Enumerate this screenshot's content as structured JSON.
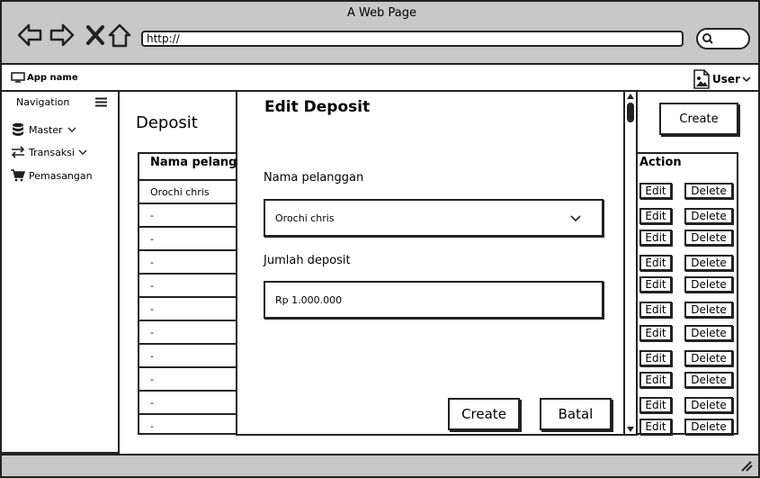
{
  "window": {
    "title": "A Web Page",
    "url": "http://"
  },
  "app": {
    "name": "App name",
    "user": "User"
  },
  "sidebar": {
    "title": "Navigation",
    "items": [
      {
        "label": "Master",
        "icon": "database-icon"
      },
      {
        "label": "Transaksi",
        "icon": "transfer-icon"
      },
      {
        "label": "Pemasangan",
        "icon": "cart-icon"
      }
    ]
  },
  "main": {
    "title": "Deposit",
    "create_label": "Create",
    "table": {
      "headers": [
        "Nama pelanggan",
        "Action"
      ],
      "rows": [
        "Orochi chris",
        "-",
        "-",
        "-",
        "-",
        "-",
        "-",
        "-",
        "-",
        "-",
        "-"
      ],
      "edit_label": "Edit",
      "delete_label": "Delete"
    }
  },
  "modal": {
    "title": "Edit Deposit",
    "customer_label": "Nama pelanggan",
    "customer_value": "Orochi chris",
    "amount_label": "Jumlah deposit",
    "amount_value": "Rp 1.000.000",
    "create_label": "Create",
    "cancel_label": "Batal"
  }
}
